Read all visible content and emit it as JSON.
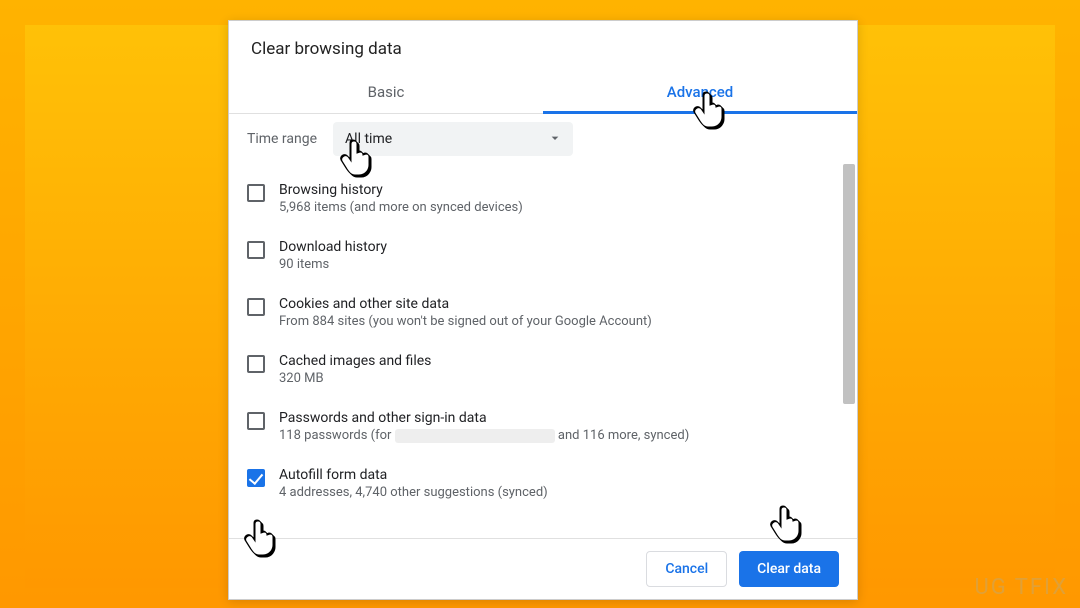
{
  "dialog": {
    "title": "Clear browsing data",
    "tabs": {
      "basic": "Basic",
      "advanced": "Advanced",
      "active": "advanced"
    },
    "time_range": {
      "label": "Time range",
      "selected": "All time"
    },
    "options": [
      {
        "checked": false,
        "title": "Browsing history",
        "desc": "5,968 items (and more on synced devices)"
      },
      {
        "checked": false,
        "title": "Download history",
        "desc": "90 items"
      },
      {
        "checked": false,
        "title": "Cookies and other site data",
        "desc": "From 884 sites (you won't be signed out of your Google Account)"
      },
      {
        "checked": false,
        "title": "Cached images and files",
        "desc": "320 MB"
      },
      {
        "checked": false,
        "title": "Passwords and other sign-in data",
        "desc_prefix": "118 passwords (for ",
        "desc_suffix": " and 116 more, synced)"
      },
      {
        "checked": true,
        "title": "Autofill form data",
        "desc": "4 addresses, 4,740 other suggestions (synced)"
      }
    ],
    "buttons": {
      "cancel": "Cancel",
      "clear": "Clear data"
    }
  },
  "watermark": "UG  TFIX"
}
